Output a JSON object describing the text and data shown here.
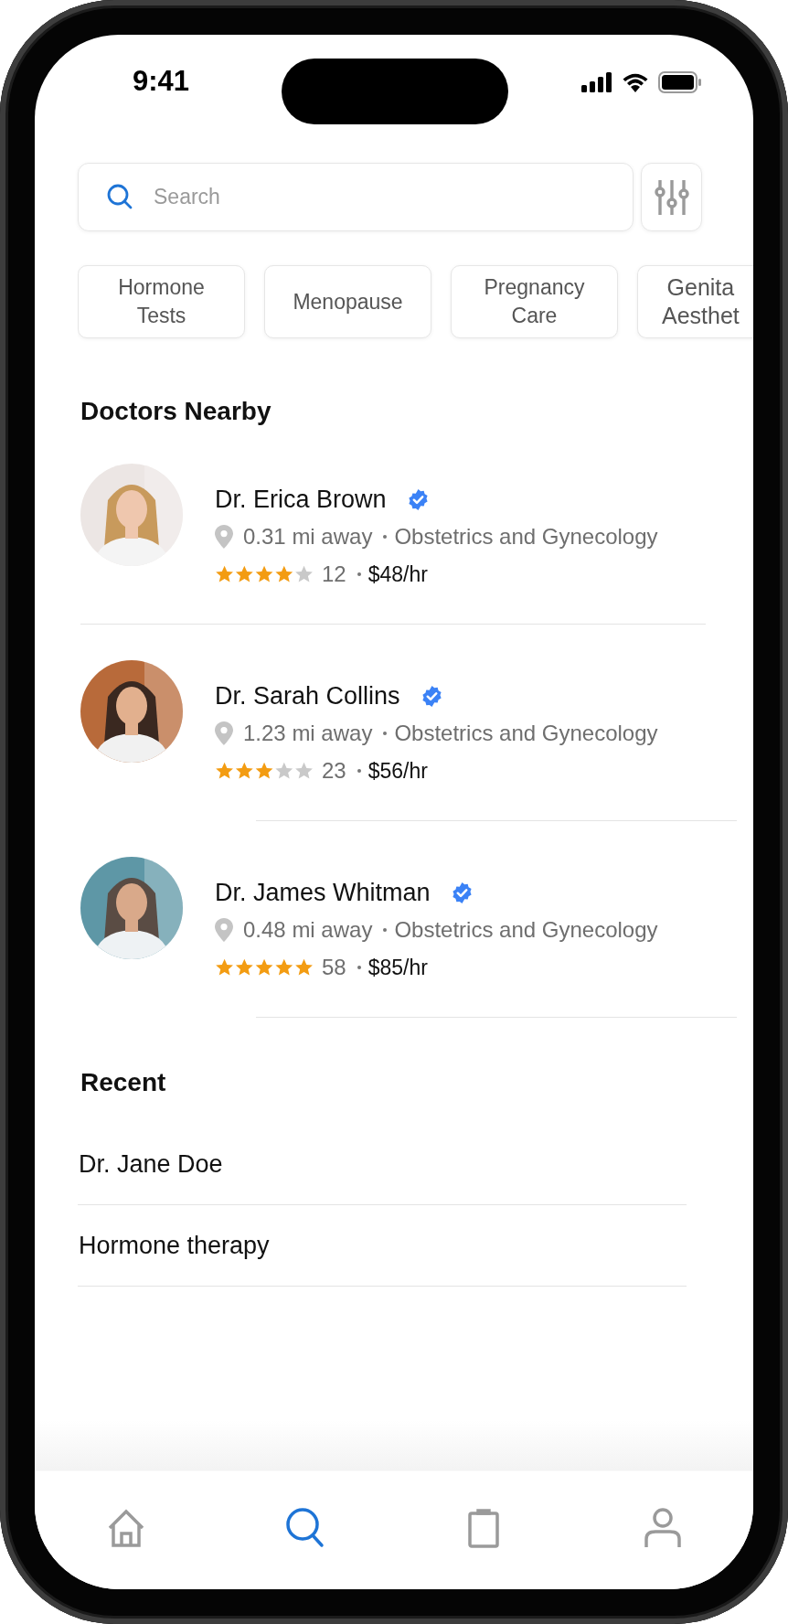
{
  "status_bar": {
    "time": "9:41"
  },
  "search": {
    "placeholder": "Search"
  },
  "categories": [
    {
      "label": "Hormone Tests"
    },
    {
      "label": "Menopause"
    },
    {
      "label": "Pregnancy Care"
    },
    {
      "label": "Genita Aesthet"
    }
  ],
  "doctors_nearby": {
    "title": "Doctors Nearby",
    "doctors": [
      {
        "name": "Dr. Erica Brown",
        "verified": true,
        "distance": "0.31 mi away",
        "specialty": "Obstetrics and Gynecology",
        "stars": 4,
        "reviews": "12",
        "rate": "$48/hr"
      },
      {
        "name": "Dr. Sarah Collins",
        "verified": true,
        "distance": "1.23 mi away",
        "specialty": "Obstetrics and Gynecology",
        "stars": 3,
        "reviews": "23",
        "rate": "$56/hr"
      },
      {
        "name": "Dr. James Whitman",
        "verified": true,
        "distance": "0.48 mi away",
        "specialty": "Obstetrics and Gynecology",
        "stars": 5,
        "reviews": "58",
        "rate": "$85/hr"
      }
    ]
  },
  "recent": {
    "title": "Recent",
    "items": [
      "Dr. Jane Doe",
      "Hormone therapy"
    ]
  },
  "tab_bar": [
    {
      "kind": "home",
      "selected": false
    },
    {
      "kind": "search",
      "selected": true
    },
    {
      "kind": "clipboard",
      "selected": false
    },
    {
      "kind": "profile",
      "selected": false
    }
  ]
}
